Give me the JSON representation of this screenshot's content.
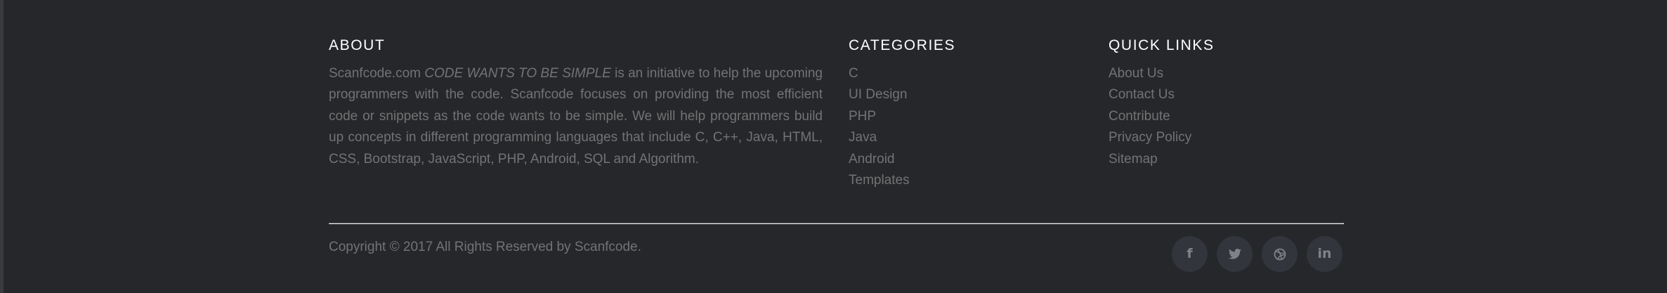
{
  "about": {
    "title": "ABOUT",
    "text_start": "Scanfcode.com ",
    "text_em": "CODE WANTS TO BE SIMPLE",
    "text_rest": " is an initiative to help the upcoming programmers with the code. Scanfcode focuses on providing the most efficient code or snippets as the code wants to be simple. We will help programmers build up concepts in different programming languages that include C, C++, Java, HTML, CSS, Bootstrap, JavaScript, PHP, Android, SQL and Algorithm."
  },
  "categories": {
    "title": "CATEGORIES",
    "items": [
      "C",
      "UI Design",
      "PHP",
      "Java",
      "Android",
      "Templates"
    ]
  },
  "quick_links": {
    "title": "QUICK LINKS",
    "items": [
      "About Us",
      "Contact Us",
      "Contribute",
      "Privacy Policy",
      "Sitemap"
    ]
  },
  "copyright": "Copyright © 2017 All Rights Reserved by Scanfcode.",
  "social": [
    {
      "icon": "facebook-icon",
      "glyph": "f"
    },
    {
      "icon": "twitter-icon",
      "glyph": ""
    },
    {
      "icon": "dribbble-icon",
      "glyph": ""
    },
    {
      "icon": "linkedin-icon",
      "glyph": "in"
    }
  ],
  "colors": {
    "background": "#26272b",
    "heading": "#ffffff",
    "text": "#737373",
    "divider": "#6a6b6f",
    "social_bg": "#33353d",
    "social_icon": "#818288"
  }
}
